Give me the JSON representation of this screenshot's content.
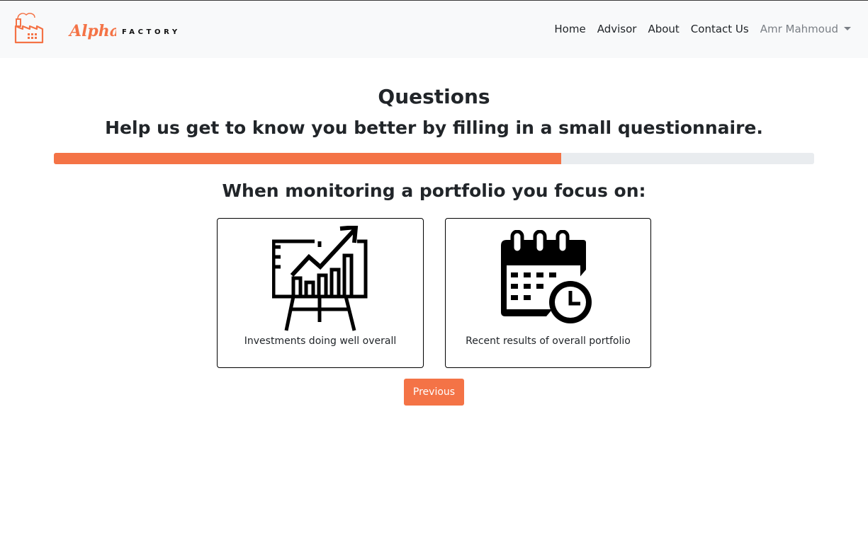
{
  "brand": {
    "script_text": "Alpha",
    "factory_text": "FACTORY"
  },
  "nav": {
    "items": [
      "Home",
      "Advisor",
      "About",
      "Contact Us"
    ],
    "user_name": "Amr Mahmoud"
  },
  "page": {
    "title": "Questions",
    "subtitle": "Help us get to know you better by filling in a small questionnaire.",
    "progress_fraction": 0.667,
    "question": "When monitoring a portfolio you focus on:",
    "options": [
      {
        "label": "Investments doing well overall",
        "icon": "presentation-growth-chart-icon"
      },
      {
        "label": "Recent results of overall portfolio",
        "icon": "calendar-clock-icon"
      }
    ],
    "previous_label": "Previous"
  },
  "colors": {
    "accent": "#f47346",
    "navbar_bg": "#f8f9fa",
    "progress_track": "#e9ecef"
  }
}
